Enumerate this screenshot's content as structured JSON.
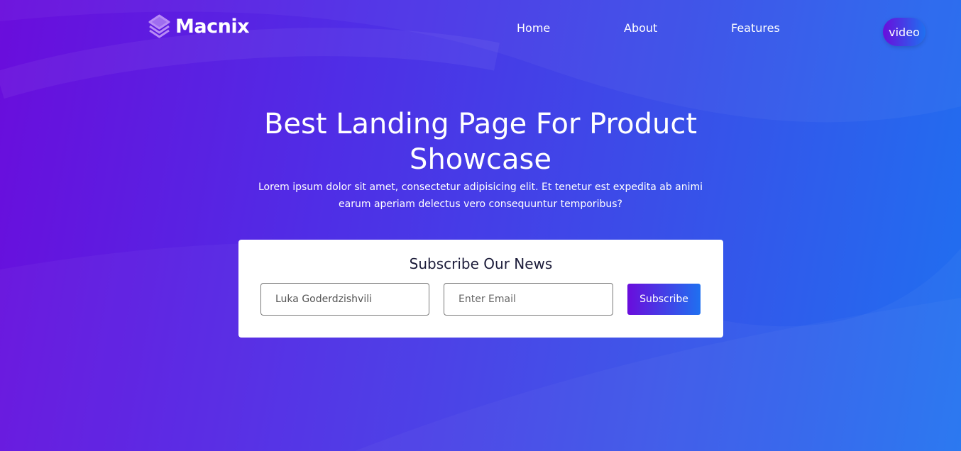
{
  "brand": {
    "name": "Macnix",
    "logo_icon": "layers-icon"
  },
  "nav": {
    "items": [
      "Home",
      "About",
      "Features"
    ],
    "video_label": "video"
  },
  "hero": {
    "title": "Best Landing Page For Product Showcase",
    "description": "Lorem ipsum dolor sit amet, consectetur adipisicing elit. Et tenetur est expedita ab animi earum aperiam delectus vero consequuntur temporibus?"
  },
  "subscribe": {
    "title": "Subscribe Our News",
    "name_value": "Luka Goderdzishvili",
    "email_placeholder": "Enter Email",
    "button_label": "Subscribe"
  },
  "colors": {
    "gradient_start": "#6a0ddc",
    "gradient_end": "#1f70f0",
    "card_title": "#1c1c3a"
  }
}
